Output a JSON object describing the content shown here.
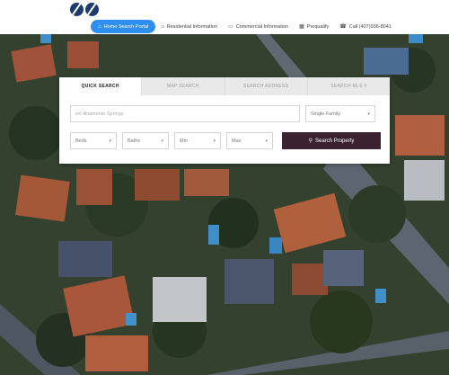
{
  "nav": {
    "items": [
      {
        "label": "Home Search Portal",
        "icon": "home-icon",
        "active": true
      },
      {
        "label": "Residential Information",
        "icon": "house-icon",
        "active": false
      },
      {
        "label": "Commercial Information",
        "icon": "building-icon",
        "active": false
      },
      {
        "label": "Prequalify",
        "icon": "calculator-icon",
        "active": false
      },
      {
        "label": "Call (407)936-8041",
        "icon": "phone-icon",
        "active": false
      }
    ]
  },
  "search": {
    "tabs": [
      {
        "label": "Quick Search",
        "active": true
      },
      {
        "label": "Map Search",
        "active": false
      },
      {
        "label": "Search Address",
        "active": false
      },
      {
        "label": "Search MLS #",
        "active": false
      }
    ],
    "location_placeholder": "ex: Altamonte Springs",
    "property_type": "Single Family",
    "beds": "Beds",
    "baths": "Baths",
    "min_price": "Min",
    "max_price": "Max",
    "button_label": "Search Property"
  },
  "colors": {
    "nav_active": "#2f8ff0",
    "button": "#3a2230",
    "logo": "#1e3a6e"
  }
}
